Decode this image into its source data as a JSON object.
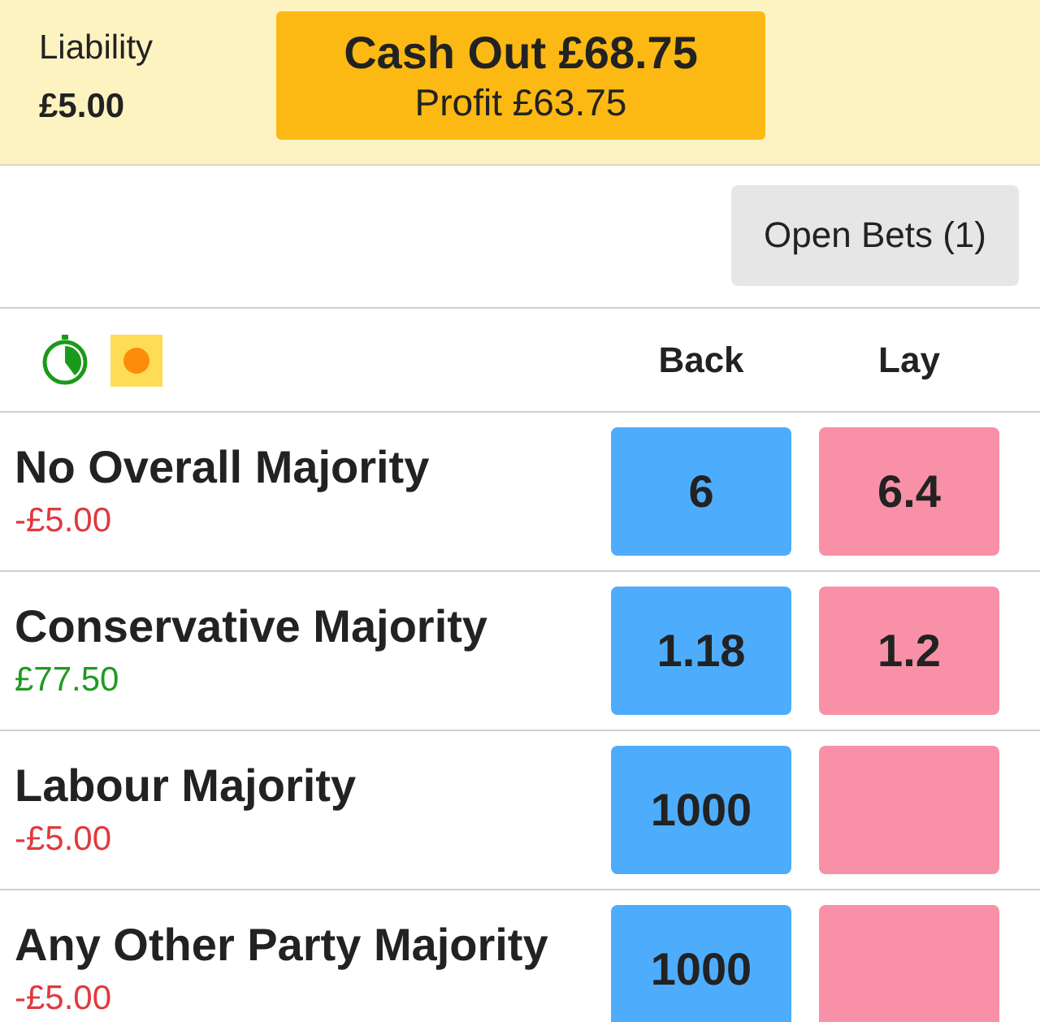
{
  "cash_out_bar": {
    "liability_label": "Liability",
    "liability": "£5.00",
    "cash_out": "Cash Out £68.75",
    "profit": "Profit £63.75"
  },
  "open_bets_button": "Open Bets (1)",
  "market_header": {
    "columns": [
      "Back",
      "Lay"
    ]
  },
  "runners": [
    {
      "name": "No Overall Majority",
      "pnl": "-£5.00",
      "color": "#e0393e",
      "back": "6",
      "lay": "6.4"
    },
    {
      "name": "Conservative Majority",
      "pnl": "£77.50",
      "color": "#1f9a1f",
      "back": "1.18",
      "lay": "1.2"
    },
    {
      "name": "Labour Majority",
      "pnl": "-£5.00",
      "color": "#e0393e",
      "back": "1000"
    },
    {
      "name": "Any Other Party Majority",
      "pnl": "-£5.00",
      "color": "#e0393e",
      "back": "1000"
    }
  ]
}
